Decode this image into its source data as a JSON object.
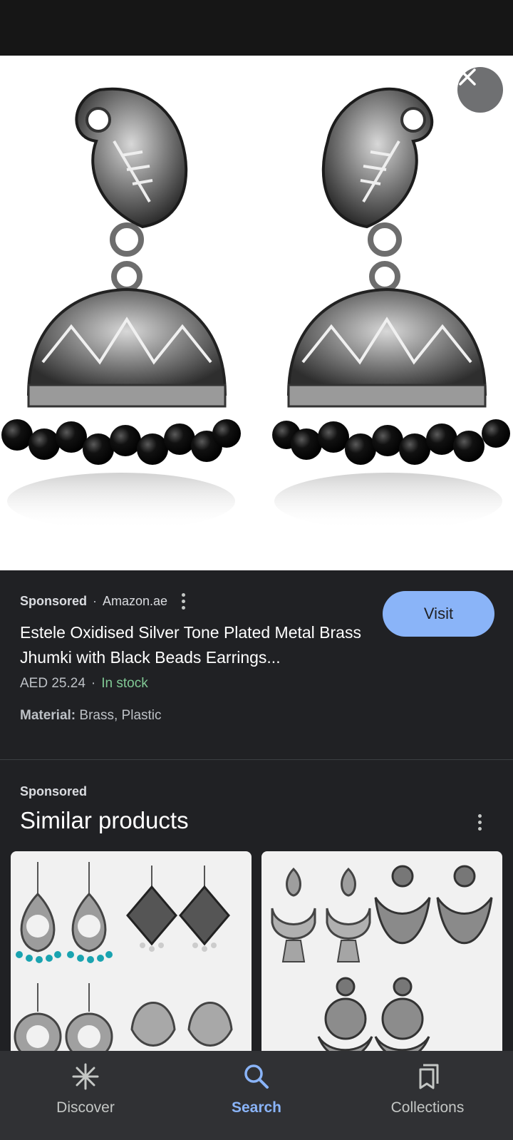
{
  "product": {
    "sponsored_label": "Sponsored",
    "separator": "·",
    "merchant": "Amazon.ae",
    "title": "Estele Oxidised Silver Tone Plated Metal Brass Jhumki with Black Beads Earrings...",
    "price": "AED 25.24",
    "stock": "In stock",
    "material_label": "Material:",
    "material_value": " Brass, Plastic",
    "visit_label": "Visit"
  },
  "similar": {
    "sponsored_label": "Sponsored",
    "title": "Similar products"
  },
  "nav": {
    "items": [
      {
        "label": "Discover",
        "icon": "asterisk-icon",
        "active": false
      },
      {
        "label": "Search",
        "icon": "search-icon",
        "active": true
      },
      {
        "label": "Collections",
        "icon": "collections-icon",
        "active": false
      }
    ]
  },
  "colors": {
    "accent": "#8ab4f8",
    "in_stock": "#81c995",
    "background": "#202124",
    "nav_background": "#303134"
  }
}
